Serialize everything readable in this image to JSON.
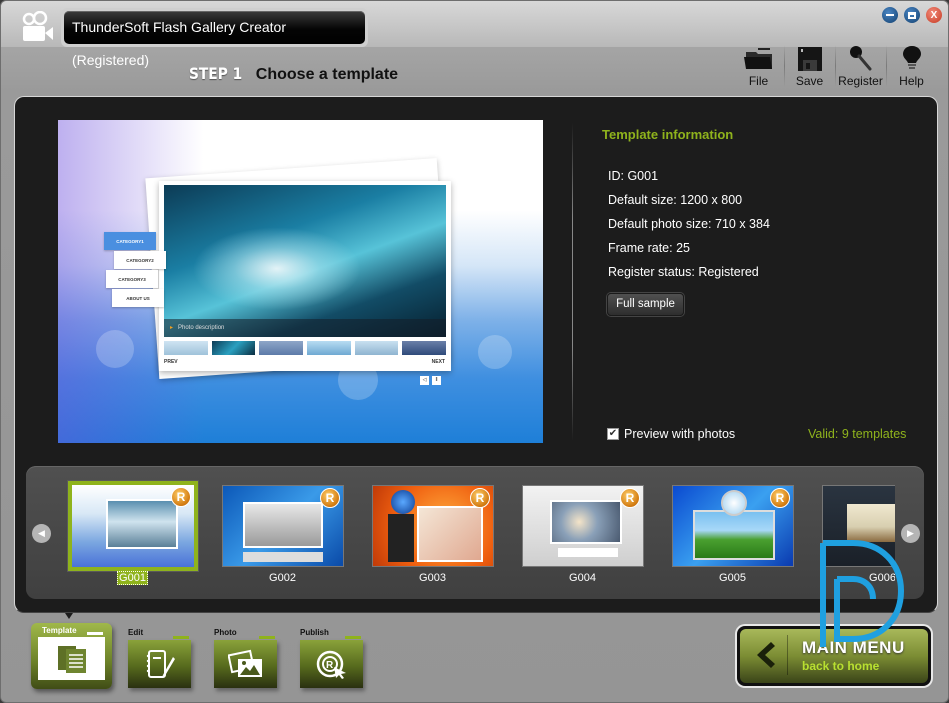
{
  "window": {
    "title": "ThunderSoft Flash Gallery Creator (Registered)",
    "controls": {
      "minimize": "minimize",
      "maximize": "maximize",
      "close": "X"
    }
  },
  "step": {
    "number": "STEP 1",
    "title": "Choose a template"
  },
  "toolbar": {
    "items": [
      {
        "label": "File",
        "icon": "folder-icon"
      },
      {
        "label": "Save",
        "icon": "floppy-icon"
      },
      {
        "label": "Register",
        "icon": "key-icon"
      },
      {
        "label": "Help",
        "icon": "lightbulb-icon"
      }
    ]
  },
  "preview": {
    "categories": [
      "CATEGORY1",
      "CATEGORY2",
      "CATEGORY3",
      "ABOUT US"
    ],
    "photo_description": "Photo description",
    "prev_label": "PREV",
    "next_label": "NEXT",
    "sound_icon": "◁",
    "pause_icon": "‖"
  },
  "template_info": {
    "heading": "Template information",
    "lines": [
      "ID: G001",
      "Default size: 1200 x 800",
      "Default photo size: 710 x 384",
      "Frame rate: 25",
      "Register status: Registered"
    ],
    "full_sample_label": "Full sample",
    "preview_with_photos_label": "Preview with photos",
    "preview_with_photos_checked": true,
    "valid_count_text": "Valid: 9 templates"
  },
  "gallery": {
    "selected": "G001",
    "templates": [
      {
        "id": "G001",
        "badge": "R"
      },
      {
        "id": "G002",
        "badge": "R"
      },
      {
        "id": "G003",
        "badge": "R"
      },
      {
        "id": "G004",
        "badge": "R"
      },
      {
        "id": "G005",
        "badge": "R"
      },
      {
        "id": "G006",
        "badge": ""
      }
    ]
  },
  "bottom_tabs": [
    {
      "label": "Template",
      "active": true
    },
    {
      "label": "Edit",
      "active": false
    },
    {
      "label": "Photo",
      "active": false
    },
    {
      "label": "Publish",
      "active": false
    }
  ],
  "main_menu": {
    "title": "MAIN MENU",
    "subtitle": "back to home"
  },
  "colors": {
    "accent": "#8fb31c",
    "panel": "#1c1c1c",
    "chrome": "#9a9a9a"
  }
}
